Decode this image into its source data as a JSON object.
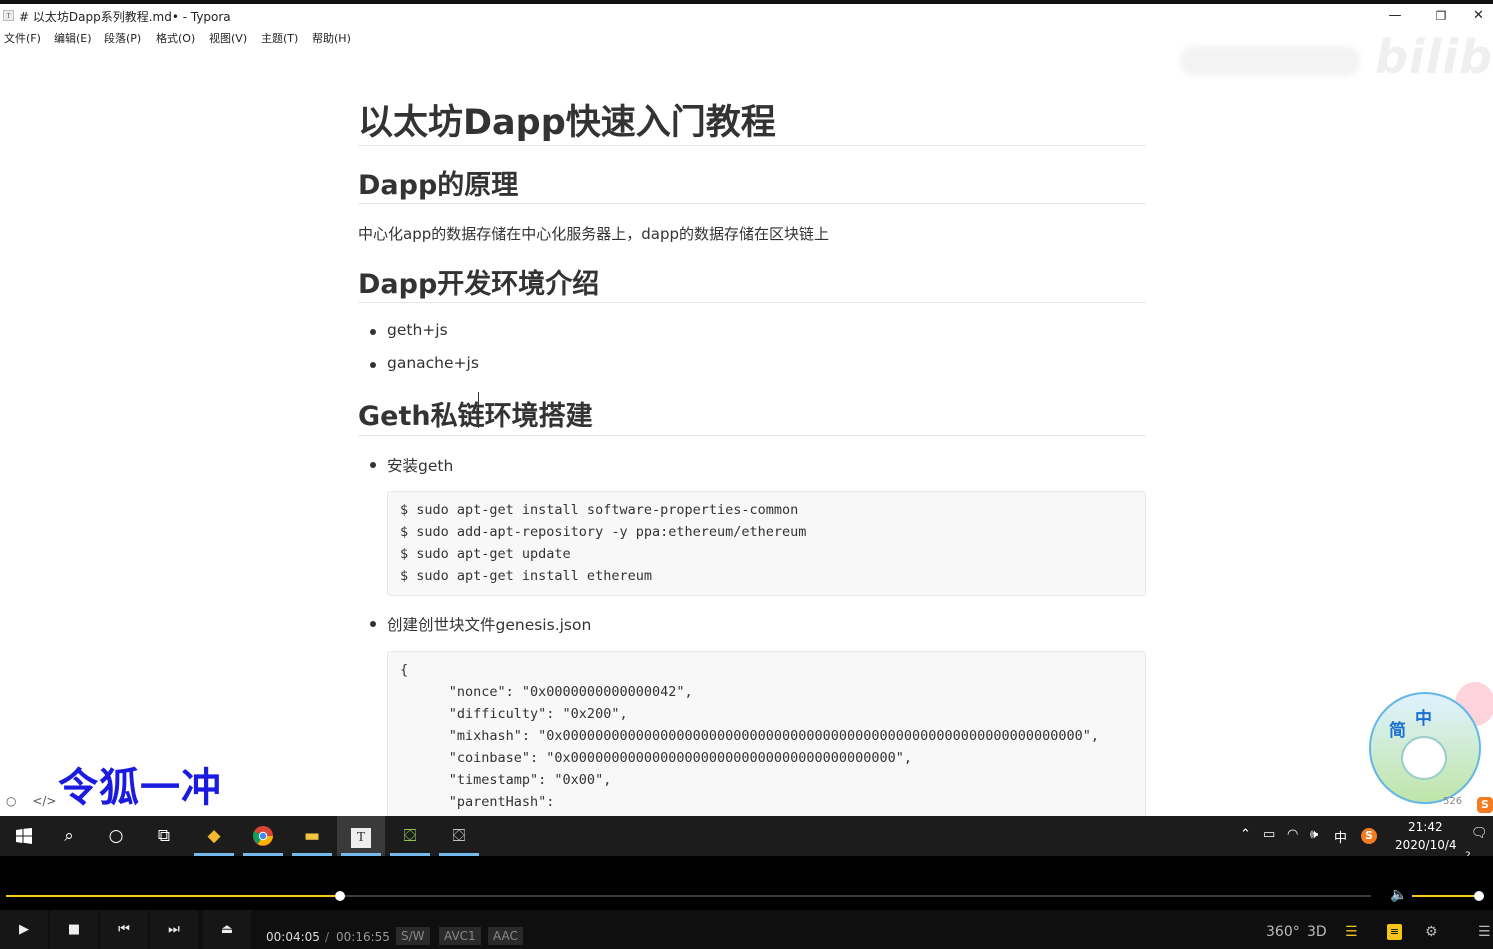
{
  "window": {
    "title": "# 以太坊Dapp系列教程.md• - Typora",
    "minimize": "—",
    "restore": "❐",
    "close": "✕"
  },
  "menu": [
    "文件(F)",
    "编辑(E)",
    "段落(P)",
    "格式(O)",
    "视图(V)",
    "主题(T)",
    "帮助(H)"
  ],
  "watermark": {
    "logo": "bilibili"
  },
  "doc": {
    "h1": "以太坊Dapp快速入门教程",
    "section1": {
      "title": "Dapp的原理",
      "text": "中心化app的数据存储在中心化服务器上，dapp的数据存储在区块链上"
    },
    "section2": {
      "title": "Dapp开发环境介绍",
      "items": [
        "geth+js",
        "ganache+js"
      ]
    },
    "section3": {
      "title": "Geth私链环境搭建",
      "item1": "安装geth",
      "code1": [
        "$ sudo apt-get install software-properties-common",
        "$ sudo add-apt-repository -y ppa:ethereum/ethereum",
        "$ sudo apt-get update",
        "$ sudo apt-get install ethereum"
      ],
      "item2": "创建创世块文件genesis.json",
      "code2": [
        "{",
        "      \"nonce\": \"0x0000000000000042\",",
        "      \"difficulty\": \"0x200\",",
        "      \"mixhash\": \"0x0000000000000000000000000000000000000000000000000000000000000000\",",
        "      \"coinbase\": \"0x0000000000000000000000000000000000000000\",",
        "      \"timestamp\": \"0x00\",",
        "      \"parentHash\":"
      ]
    }
  },
  "overlay_text": "令狐一冲",
  "sticker": {
    "jian": "简",
    "zhong": "中",
    "count": "526"
  },
  "taskbar": {
    "tray_ime": "中",
    "time": "21:42",
    "date": "2020/10/4",
    "notification_count": "2"
  },
  "player": {
    "current_time": "00:04:05",
    "separator": "/",
    "total_time": "00:16:55",
    "progress": 0.245,
    "volume": 0.95,
    "badges": [
      "S/W",
      "AVC1",
      "AAC"
    ],
    "right_buttons": [
      "360°",
      "3D"
    ]
  },
  "colors": {
    "accent": "#f5c518",
    "overlay_blue": "#1b1be0",
    "taskbar": "#1c1c1c"
  }
}
